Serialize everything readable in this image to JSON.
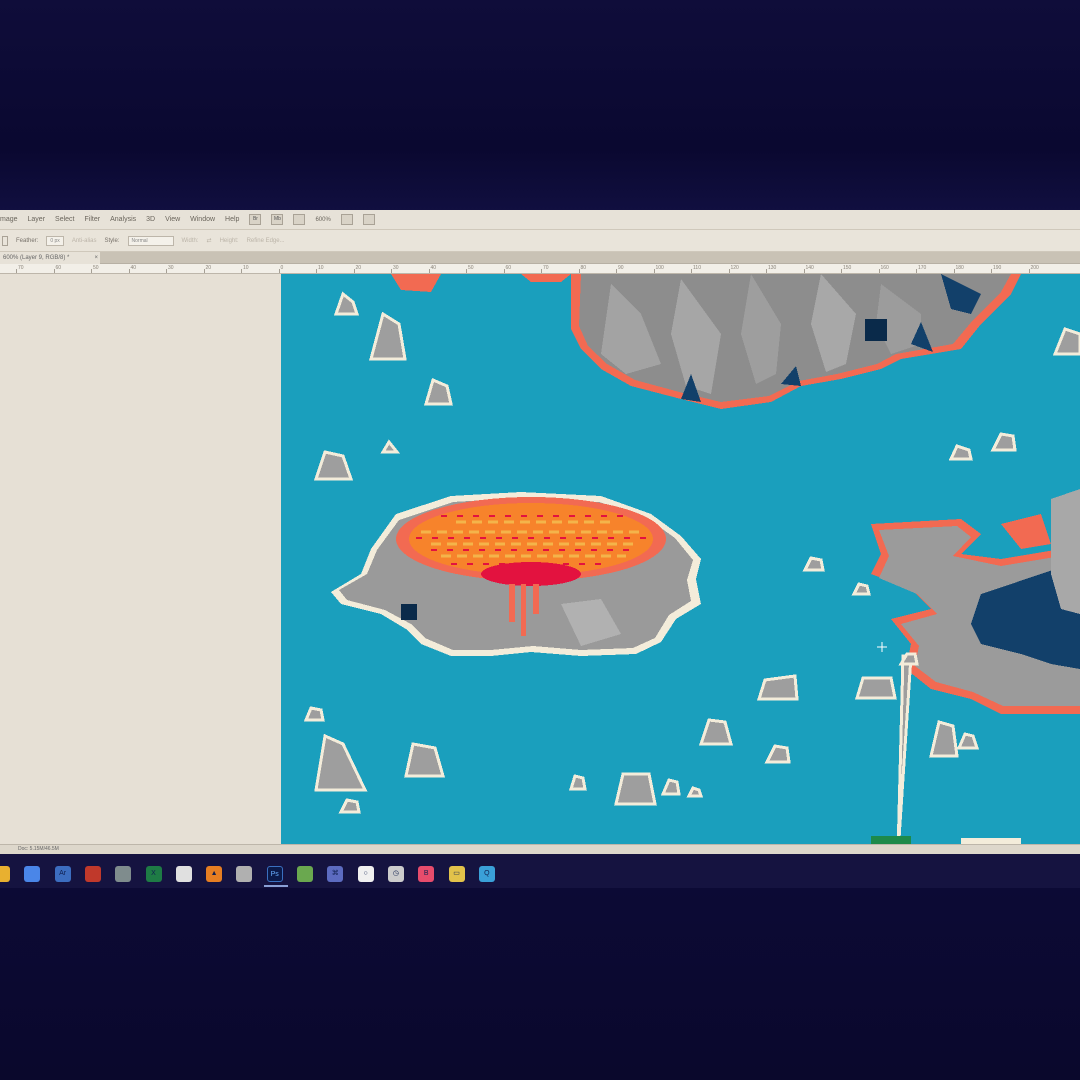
{
  "menu": {
    "items": [
      "mage",
      "Layer",
      "Select",
      "Filter",
      "Analysis",
      "3D",
      "View",
      "Window",
      "Help"
    ],
    "bridge_label": "Br",
    "minibridge_label": "Mb",
    "zoom": "600%"
  },
  "options": {
    "feather_label": "Feather:",
    "feather_value": "0 px",
    "antialias_label": "Anti-alias",
    "style_label": "Style:",
    "style_value": "Normal",
    "width_label": "Width:",
    "height_label": "Height:",
    "refine_label": "Refine Edge..."
  },
  "document": {
    "tab_title": "600% (Layer 9, RGB/8) *",
    "tab_close": "×",
    "status": "Doc: 5.15M/46.5M"
  },
  "ruler": {
    "ticks": [
      "70",
      "60",
      "50",
      "40",
      "30",
      "20",
      "10",
      "0",
      "10",
      "20",
      "30",
      "40",
      "50",
      "60",
      "70",
      "80",
      "90",
      "100",
      "110",
      "120",
      "130",
      "140",
      "150",
      "160",
      "170",
      "180",
      "190",
      "200"
    ]
  },
  "colors": {
    "water": "#1a9fbd",
    "rock": "#9a9a9a",
    "lava": "#f7532f",
    "lava_core": "#e3123f",
    "bezel": "#0d0b33"
  },
  "taskbar": {
    "icons": [
      "chrome-icon",
      "acrobat-icon",
      "filezilla-icon",
      "network-icon",
      "excel-icon",
      "chat-icon",
      "vlc-icon",
      "tool-icon",
      "photoshop-icon",
      "notepad-icon",
      "visual-studio-icon",
      "obs-icon",
      "clock-icon",
      "app-icon",
      "folder-icon",
      "qt-icon"
    ],
    "photoshop_label": "Ps"
  }
}
